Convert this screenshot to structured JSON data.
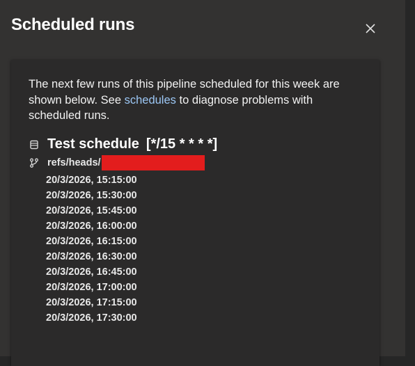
{
  "dialog": {
    "title": "Scheduled runs",
    "close_icon": "close-icon"
  },
  "description": {
    "before_link": "The next few runs of this pipeline scheduled for this week are shown below. See ",
    "link_text": "schedules",
    "after_link": " to diagnose problems with scheduled runs."
  },
  "schedule": {
    "icon": "schedule-icon",
    "name": "Test schedule",
    "cron": "[*/15 * * * *]",
    "branch_icon": "branch-icon",
    "branch_prefix": "refs/heads/",
    "runs": [
      "20/3/2026, 15:15:00",
      "20/3/2026, 15:30:00",
      "20/3/2026, 15:45:00",
      "20/3/2026, 16:00:00",
      "20/3/2026, 16:15:00",
      "20/3/2026, 16:30:00",
      "20/3/2026, 16:45:00",
      "20/3/2026, 17:00:00",
      "20/3/2026, 17:15:00",
      "20/3/2026, 17:30:00"
    ]
  },
  "colors": {
    "background": "#333231",
    "card": "#2b2a2a",
    "link": "#9cc7f5",
    "redaction": "#e31d1d"
  }
}
